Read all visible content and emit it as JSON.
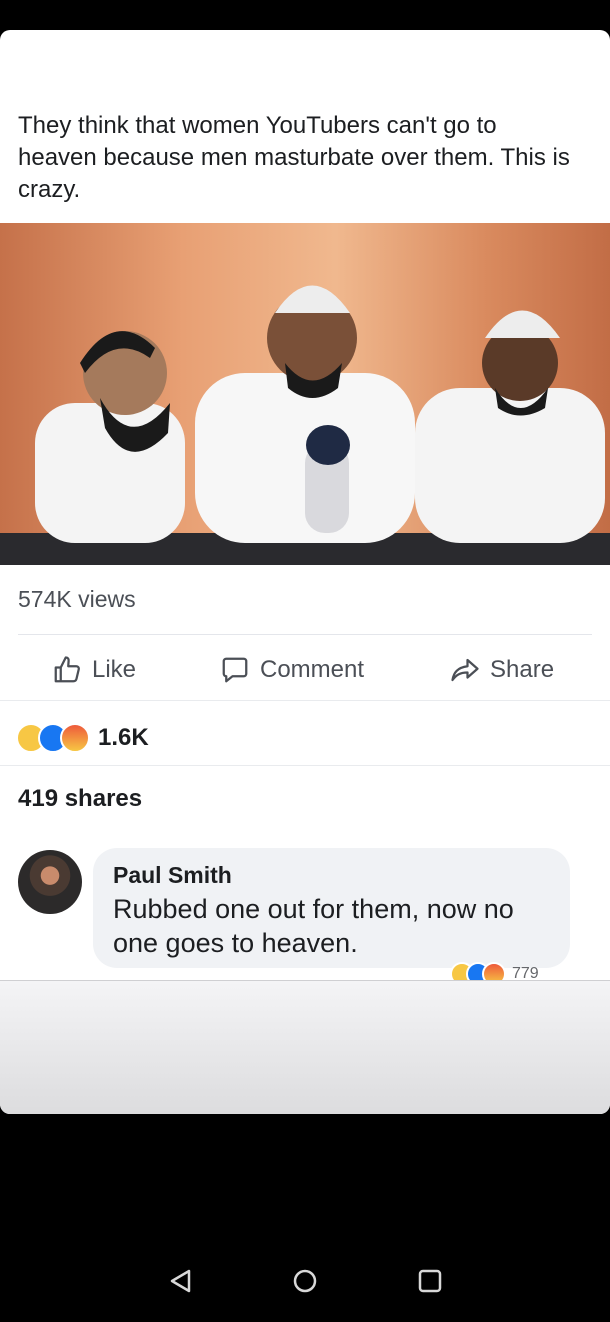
{
  "post": {
    "text": "They think that women YouTubers can't go to heaven because men masturbate over them. This is crazy.",
    "views": "574K views"
  },
  "actions": {
    "like_label": "Like",
    "comment_label": "Comment",
    "share_label": "Share"
  },
  "reactions": {
    "count": "1.6K",
    "icons": [
      "haha-icon",
      "like-icon",
      "angry-icon"
    ]
  },
  "shares": "419 shares",
  "comment": {
    "author": "Paul Smith",
    "text": "Rubbed one out for them, now no one goes to heaven.",
    "reaction_count": "779"
  },
  "colors": {
    "text": "#1c1e21",
    "secondary": "#4b4f56",
    "like_blue": "#1877f2",
    "bubble": "#f0f2f5"
  }
}
